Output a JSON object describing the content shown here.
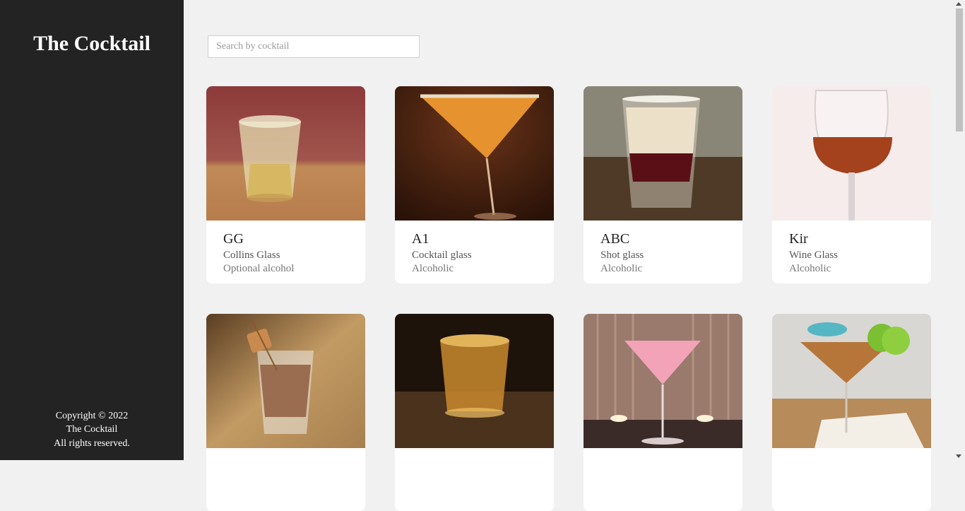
{
  "sidebar": {
    "title": "The Cocktail",
    "footer": [
      "Copyright © 2022",
      "The Cocktail",
      "All rights reserved."
    ]
  },
  "search": {
    "placeholder": "Search by cocktail",
    "value": ""
  },
  "cards": [
    {
      "name": "GG",
      "glass": "Collins Glass",
      "kind": "Optional alcohol",
      "image": "rocks-glass-pale-drink-photo"
    },
    {
      "name": "A1",
      "glass": "Cocktail glass",
      "kind": "Alcoholic",
      "image": "martini-orange-drink-photo"
    },
    {
      "name": "ABC",
      "glass": "Shot glass",
      "kind": "Alcoholic",
      "image": "layered-shot-photo"
    },
    {
      "name": "Kir",
      "glass": "Wine Glass",
      "kind": "Alcoholic",
      "image": "red-wine-glass-photo"
    },
    {
      "name": "",
      "glass": "",
      "kind": "",
      "image": "creamy-shot-with-garnish-photo"
    },
    {
      "name": "",
      "glass": "",
      "kind": "",
      "image": "whiskey-shot-glass-photo"
    },
    {
      "name": "",
      "glass": "",
      "kind": "",
      "image": "pink-martini-candles-photo"
    },
    {
      "name": "",
      "glass": "",
      "kind": "",
      "image": "martini-lime-umbrella-photo"
    }
  ]
}
